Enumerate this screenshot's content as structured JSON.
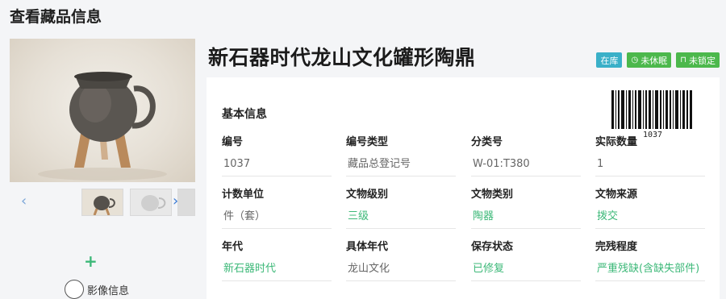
{
  "page": {
    "title": "查看藏品信息"
  },
  "gallery": {
    "prev_arrow": "‹",
    "next_arrow": "›",
    "add_button": "+",
    "imaging_label": "影像信息"
  },
  "item": {
    "title": "新石器时代龙山文化罐形陶鼎"
  },
  "badges": [
    {
      "label": "在库",
      "color": "#3ab0c8"
    },
    {
      "label": "未休眠",
      "icon": "clock-icon",
      "color": "#4cb84c"
    },
    {
      "label": "未锁定",
      "icon": "lock-icon",
      "color": "#4cb84c"
    }
  ],
  "info": {
    "section_title": "基本信息",
    "barcode_number": "1037",
    "fields": [
      {
        "label": "编号",
        "value": "1037"
      },
      {
        "label": "编号类型",
        "value": "藏品总登记号"
      },
      {
        "label": "分类号",
        "value": "W-01:T380"
      },
      {
        "label": "实际数量",
        "value": "1"
      },
      {
        "label": "计数单位",
        "value": "件（套）"
      },
      {
        "label": "文物级别",
        "value": "三级"
      },
      {
        "label": "文物类别",
        "value": "陶器"
      },
      {
        "label": "文物来源",
        "value": "拨交"
      },
      {
        "label": "年代",
        "value": "新石器时代"
      },
      {
        "label": "具体年代",
        "value": "龙山文化"
      },
      {
        "label": "保存状态",
        "value": "已修复"
      },
      {
        "label": "完残程度",
        "value": "严重残缺(含缺失部件)"
      }
    ]
  },
  "colors": {
    "accent_green": "#3cb878",
    "badge_blue": "#3ab0c8",
    "badge_green": "#4cb84c"
  }
}
